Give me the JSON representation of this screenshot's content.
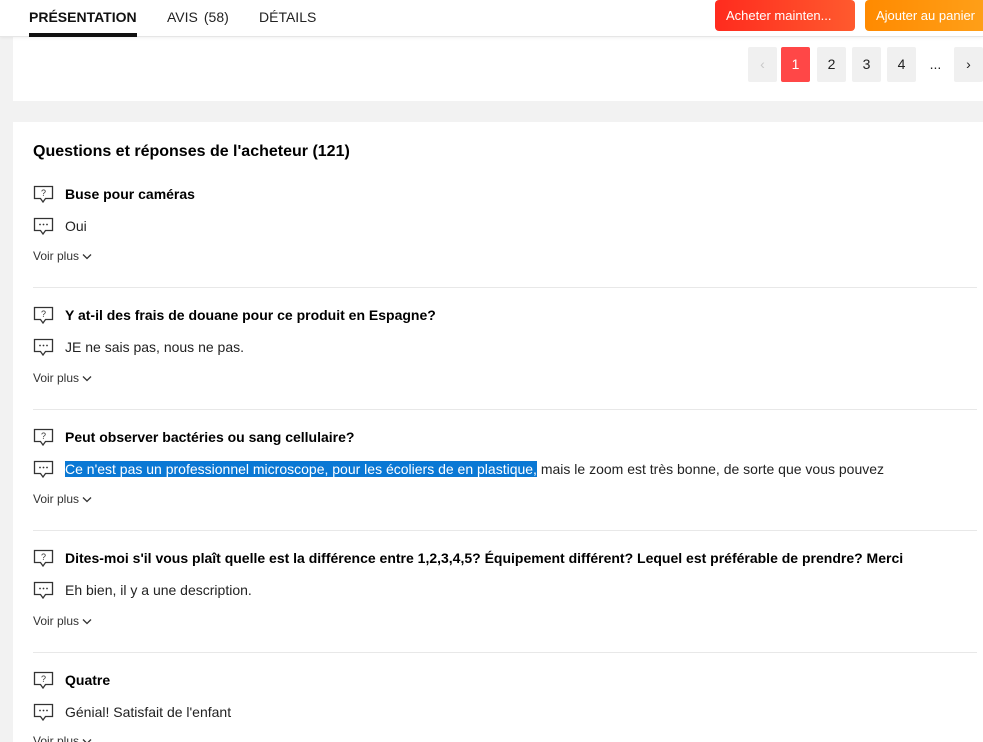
{
  "tabs": {
    "presentation": "PRÉSENTATION",
    "avis": "AVIS",
    "avis_count": "(58)",
    "details": "DÉTAILS"
  },
  "actions": {
    "buy_now": "Acheter mainten...",
    "add_cart": "Ajouter au panier"
  },
  "pagination": {
    "prev": "‹",
    "pages": [
      "1",
      "2",
      "3",
      "4"
    ],
    "current": "1",
    "ellipsis": "...",
    "next": "›"
  },
  "qa": {
    "title": "Questions et réponses de l'acheteur (121)",
    "more_label": "Voir plus",
    "items": [
      {
        "question": "Buse pour caméras",
        "answer": "Oui"
      },
      {
        "question": "Y at-il des frais de douane pour ce produit en Espagne?",
        "answer": "JE ne sais pas, nous ne pas."
      },
      {
        "question": "Peut observer bactéries ou sang cellulaire?",
        "answer_selected": "Ce n'est pas un professionnel microscope, pour les écoliers de en plastique,",
        "answer_rest": " mais le zoom est très bonne, de sorte que vous pouvez"
      },
      {
        "question": "Dites-moi s'il vous plaît quelle est la différence entre 1,2,3,4,5? Équipement différent? Lequel est préférable de prendre? Merci",
        "answer": "Eh bien, il y a une description."
      },
      {
        "question": "Quatre",
        "answer": "Génial! Satisfait de l'enfant"
      }
    ]
  },
  "colors": {
    "primary_red": "#ff4747",
    "buy_gradient": "#ff2b1e",
    "cart_gradient": "#ff8a00",
    "selection": "#0a78d4"
  },
  "icons": {
    "question": "question-bubble-icon",
    "answer": "answer-bubble-icon",
    "chevron": "chevron-down-icon"
  }
}
